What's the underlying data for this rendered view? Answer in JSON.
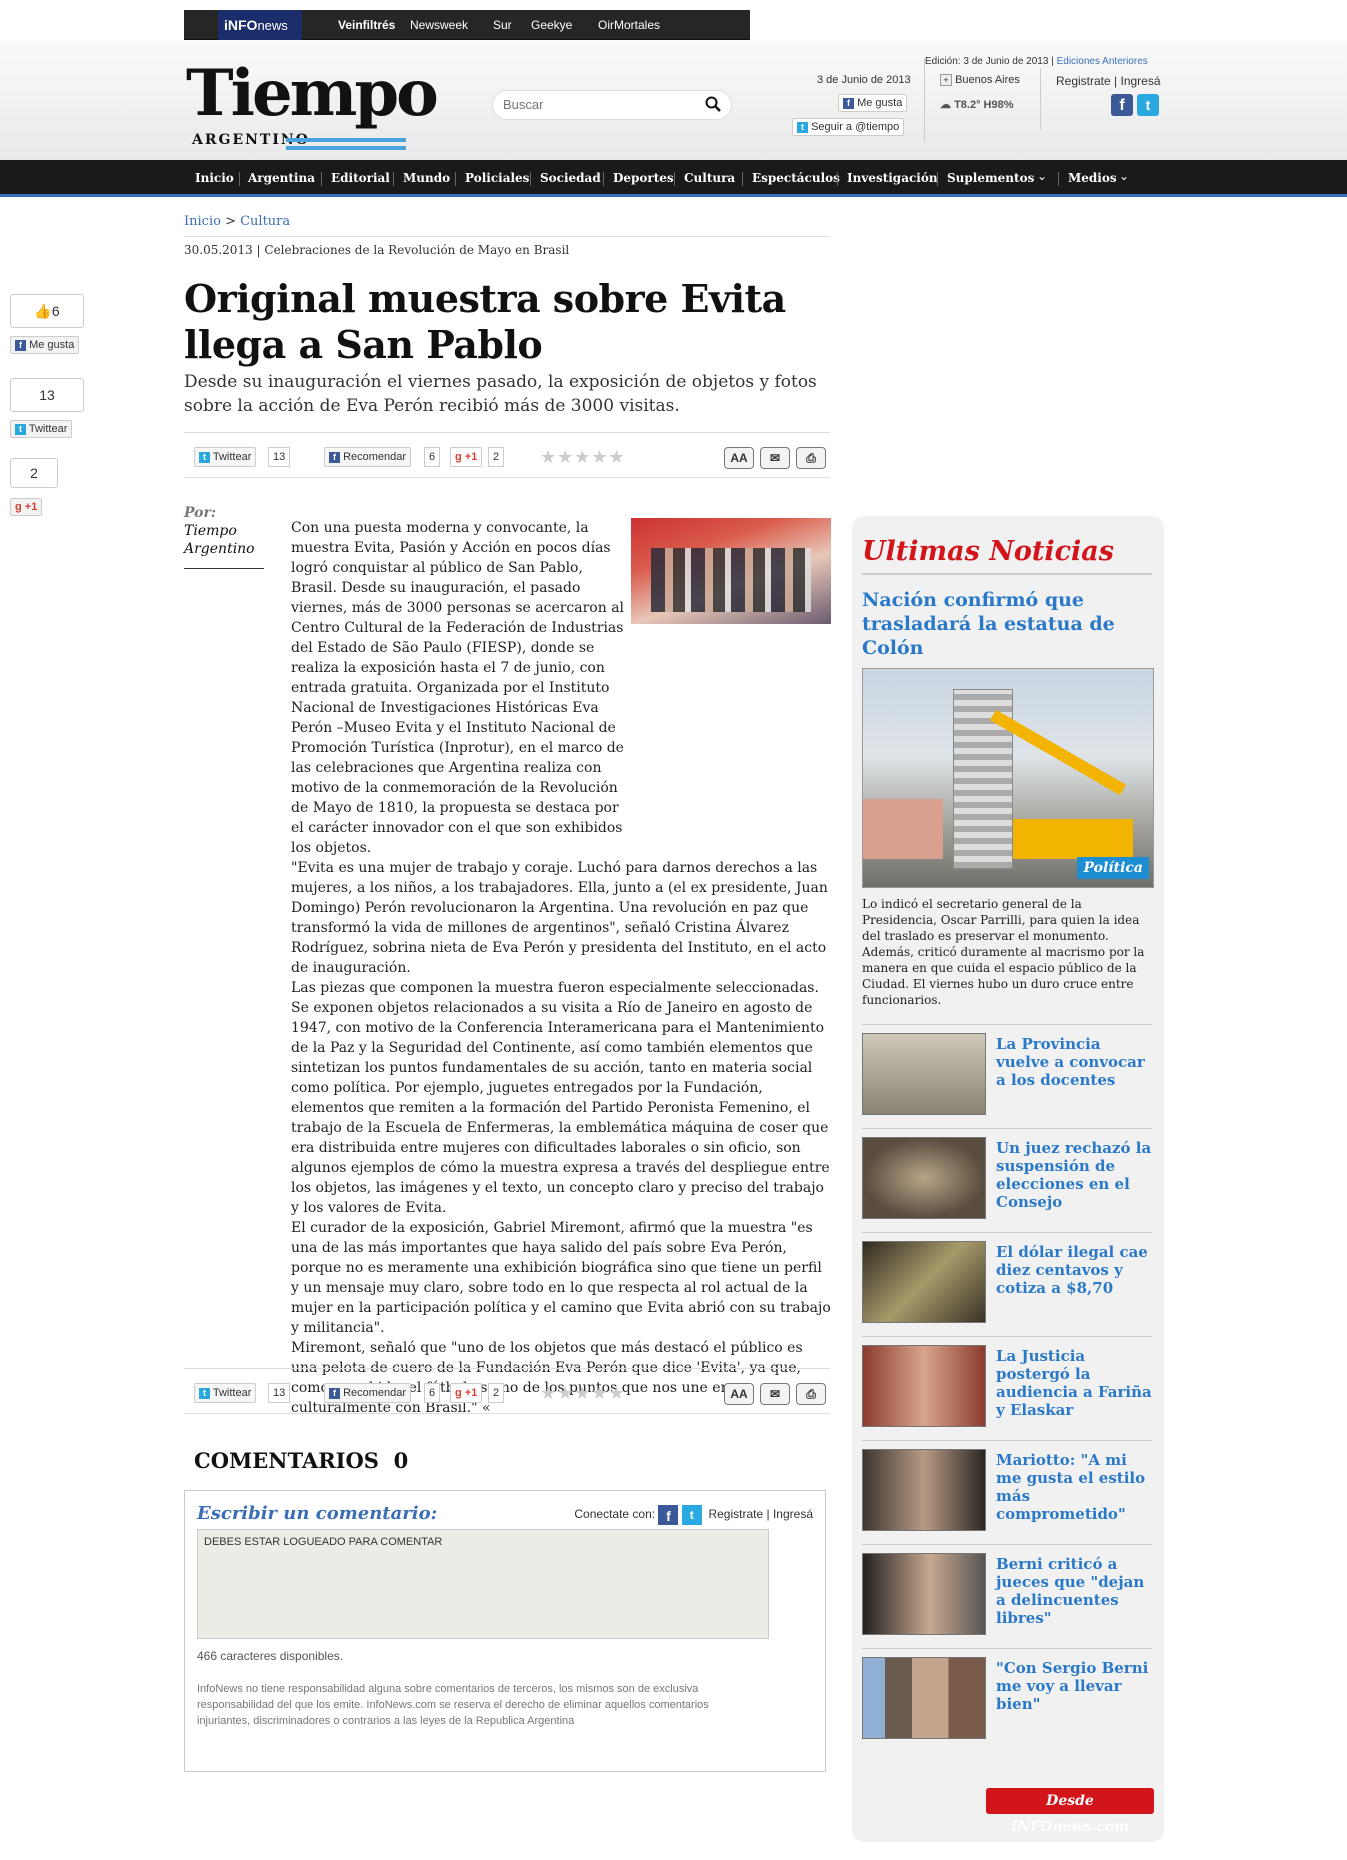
{
  "topbar": {
    "brand_main": "iNFO",
    "brand_sub": "news",
    "links": [
      "Veinfiltrés",
      "Newsweek",
      "Sur",
      "Geekye",
      "OirMortales"
    ]
  },
  "header": {
    "logo_title": "Tiempo",
    "logo_subtitle": "ARGENTINO",
    "search_placeholder": "Buscar",
    "date": "3 de Junio de 2013",
    "like_label": "Me gusta",
    "follow_label": "Seguir a @tiempo",
    "edition": "Edición: 3 de Junio de 2013 |",
    "prev_editions": "Ediciones Anteriores",
    "city": "Buenos Aires",
    "weather": "T8.2° H98%",
    "register": "Registrate",
    "login": "Ingresá"
  },
  "nav": {
    "items": [
      "Inicio",
      "Argentina",
      "Editorial",
      "Mundo",
      "Policiales",
      "Sociedad",
      "Deportes",
      "Cultura",
      "Espectáculos",
      "Investigación",
      "Suplementos",
      "Medios"
    ]
  },
  "breadcrumb": {
    "home": "Inicio",
    "sep": " > ",
    "section": "Cultura"
  },
  "article": {
    "date": "30.05.2013",
    "kicker": "Celebraciones de la Revolución de Mayo en Brasil",
    "title": "Original muestra sobre Evita llega a San Pablo",
    "subtitle": "Desde su inauguración el viernes pasado, la exposición de objetos y fotos sobre la acción de Eva Perón recibió más de 3000 visitas.",
    "author_label": "Por:",
    "author_name": "Tiempo Argentino",
    "paragraphs": [
      "Con una puesta moderna y convocante, la muestra Evita, Pasión y Acción en pocos días logró conquistar al público de San Pablo, Brasil. Desde su inauguración, el pasado viernes, más de 3000 personas se acercaron al Centro Cultural de la Federación de Industrias del Estado de São Paulo (FIESP), donde se realiza la exposición hasta el 7 de junio, con entrada gratuita. Organizada por el Instituto Nacional de Investigaciones Históricas Eva Perón –Museo Evita y el Instituto Nacional de Promoción Turística (Inprotur), en el marco de las celebraciones que Argentina realiza con motivo de la conmemoración de la Revolución de Mayo de 1810, la propuesta se destaca por el carácter innovador con el que son exhibidos los objetos.",
      " \"Evita es una mujer de trabajo y coraje. Luchó para darnos derechos a las mujeres, a los niños, a los trabajadores. Ella, junto a (el ex presidente, Juan Domingo) Perón revolucionaron la Argentina. Una revolución en paz que transformó la vida de millones de argentinos\", señaló Cristina Álvarez Rodríguez, sobrina nieta de Eva Perón y presidenta del Instituto, en el acto de inauguración.",
      "Las piezas que componen la muestra fueron especialmente seleccionadas. Se exponen objetos relacionados a su visita a Río de Janeiro en agosto de 1947, con motivo de la Conferencia Interamericana para el Mantenimiento de la Paz y la Seguridad del Continente, así como también elementos que sintetizan los puntos fundamentales de su acción, tanto en materia social como política. Por ejemplo, juguetes entregados por la Fundación, elementos que remiten a la formación del Partido Peronista Femenino, el trabajo de la Escuela de Enfermeras, la emblemática máquina de coser que era distribuida entre mujeres con dificultades laborales o sin oficio, son algunos ejemplos de cómo la muestra expresa a través del despliegue entre los objetos, las imágenes y el texto, un concepto claro y preciso del trabajo y los valores de Evita.",
      " El curador de la exposición, Gabriel Miremont, afirmó que la muestra \"es una de las más importantes que haya salido del país sobre Eva Perón, porque no es meramente una exhibición biográfica sino que tiene un perfil y un mensaje muy claro, sobre todo en lo que respecta al rol actual de la mujer en la participación política y el camino que Evita abrió con su trabajo y militancia\".",
      " Miremont, señaló que \"uno de los objetos que más destacó el público es una pelota de cuero de la Fundación Eva Perón que dice 'Evita', ya que, como es sabido, el fútbol es uno de los puntos que nos une en culturalmente con Brasil.\" «"
    ]
  },
  "share": {
    "twitter_label": "Twittear",
    "twitter_count": "13",
    "recommend_label": "Recomendar",
    "recommend_count": "6",
    "gplus_label": "+1",
    "gplus_count": "2",
    "stars": "★★★★★",
    "font_label": "AA",
    "email_icon": "envelope-icon",
    "print_icon": "printer-icon"
  },
  "left_social": {
    "like_count": "6",
    "like_label": "Me gusta",
    "tweet_count": "13",
    "tweet_label": "Twittear",
    "gplus_count": "2",
    "gplus_label": "+1"
  },
  "comments": {
    "heading": "COMENTARIOS",
    "count": "0",
    "write_label": "Escribir un comentario:",
    "connect_label": "Conectate con:",
    "register": "Registrate",
    "login": "Ingresá",
    "textarea_value": "DEBES ESTAR LOGUEADO PARA COMENTAR",
    "available": "466 caracteres disponibles.",
    "disclaimer": "InfoNews no tiene responsabilidad alguna sobre comentarios de terceros, los mismos son de exclusiva responsabilidad del que los emite. InfoNews.com se reserva el derecho de eliminar aquellos comentarios injuriantes, discriminadores o contrarios a las leyes de la Republica Argentina"
  },
  "sidebar": {
    "title": "Ultimas Noticias",
    "lead_headline": "Nación confirmó que trasladará la estatua de Colón",
    "lead_tag": "Política",
    "lead_text": "Lo indicó el secretario general de la Presidencia, Oscar Parrilli, para quien la idea del traslado es preservar el monumento. Además, criticó duramente al macrismo por la manera en que cuida el espacio público de la Ciudad. El viernes hubo un duro cruce entre funcionarios.",
    "news": [
      {
        "headline": "La Provincia vuelve a convocar a los docentes",
        "color": "#8a8272"
      },
      {
        "headline": "Un juez rechazó la suspensión de elecciones en el Consejo",
        "color": "#5a4d3f"
      },
      {
        "headline": "El dólar ilegal cae diez centavos y cotiza a $8,70",
        "color": "#6b5f3e"
      },
      {
        "headline": "La Justicia postergó la audiencia a Fariña y Elaskar",
        "color": "#8c3b2e"
      },
      {
        "headline": "Mariotto: \"A mi me gusta el estilo más comprometido\"",
        "color": "#3d3630"
      },
      {
        "headline": "Berni criticó a jueces que \"dejan a delincuentes libres\"",
        "color": "#444444"
      },
      {
        "headline": "\"Con Sergio Berni me voy a llevar bien\"",
        "color": "#6a5a4e"
      }
    ],
    "footer_badge": "Desde INFOnews.com"
  }
}
